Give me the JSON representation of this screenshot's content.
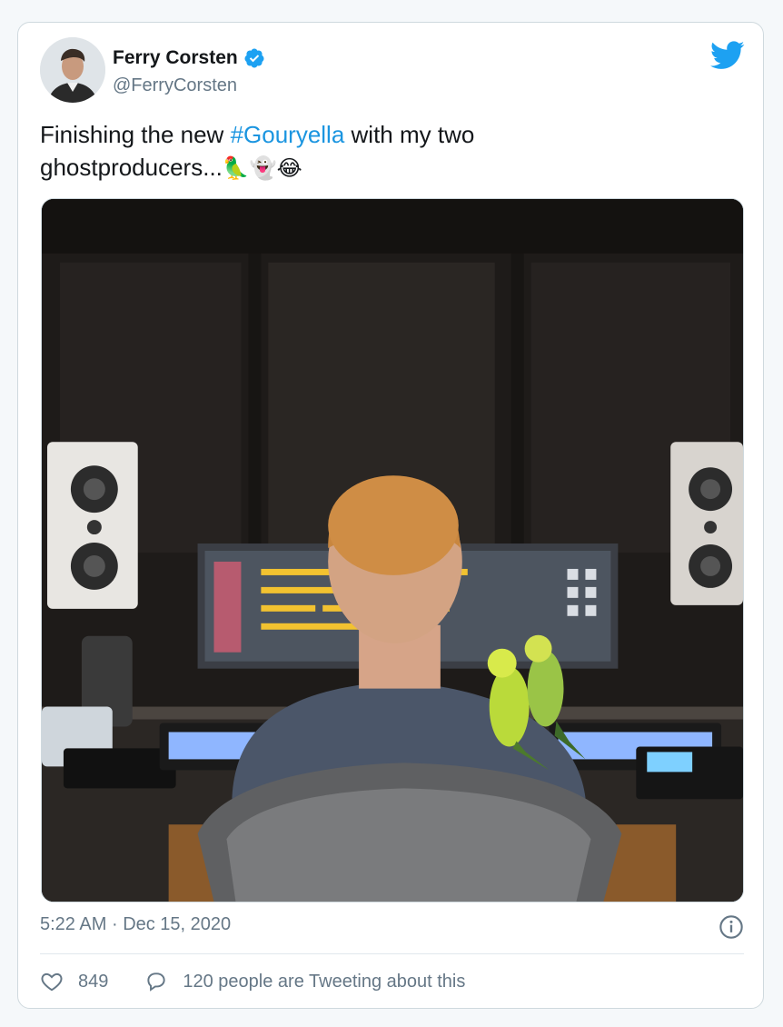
{
  "author": {
    "name": "Ferry Corsten",
    "handle": "@FerryCorsten"
  },
  "tweet": {
    "text_before": "Finishing the new ",
    "hashtag": "#Gouryella",
    "text_after_line1": " with my two",
    "text_line2": "ghostproducers...",
    "emojis": [
      "🦜",
      "👻",
      "😂"
    ]
  },
  "meta": {
    "time": "5:22 AM",
    "separator": "·",
    "date": "Dec 15, 2020"
  },
  "actions": {
    "likes": "849",
    "replies_text": "120 people are Tweeting about this"
  },
  "icons": {
    "verified": "verified-badge-icon",
    "brand": "twitter-bird-icon",
    "info": "info-icon",
    "like": "heart-icon",
    "reply": "speech-bubble-icon"
  },
  "colors": {
    "brand_blue": "#1da1f2",
    "hashtag": "#1b95e0",
    "secondary_text": "#657786",
    "primary_text": "#14171a",
    "border": "#cfd9de"
  }
}
